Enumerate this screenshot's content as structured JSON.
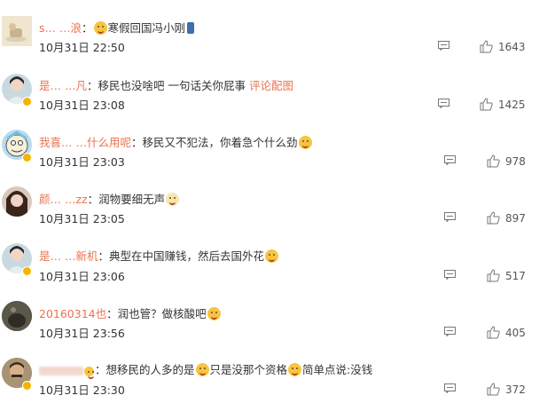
{
  "comments": [
    {
      "username": "s… …浪",
      "separator": "：",
      "text": "寒假回国冯小刚",
      "link": "",
      "time": "10月31日 22:50",
      "likes": "1643"
    },
    {
      "username": "是… …凡",
      "separator": "：",
      "text": "移民也没啥吧 一句话关你屁事 ",
      "link": "评论配图",
      "time": "10月31日 23:08",
      "likes": "1425"
    },
    {
      "username": "我喜… …什么用呢",
      "separator": "：",
      "text": "移民又不犯法，你着急个什么劲",
      "link": "",
      "time": "10月31日 23:03",
      "likes": "978"
    },
    {
      "username": "颜… …zz",
      "separator": "：",
      "text": "润物要细无声",
      "link": "",
      "time": "10月31日 23:05",
      "likes": "897"
    },
    {
      "username": "是… …新机",
      "separator": "：",
      "text": "典型在中国赚钱，然后去国外花",
      "link": "",
      "time": "10月31日 23:06",
      "likes": "517"
    },
    {
      "username": "20160314也",
      "separator": "：",
      "text": "润也管？做核酸吧",
      "link": "",
      "time": "10月31日 23:56",
      "likes": "405"
    },
    {
      "username": "",
      "separator": "：",
      "text": "想移民的人多的是",
      "text2": "只是没那个资格",
      "text3": "简单点说:没钱",
      "link": "",
      "time": "10月31日 23:30",
      "likes": "372"
    }
  ]
}
